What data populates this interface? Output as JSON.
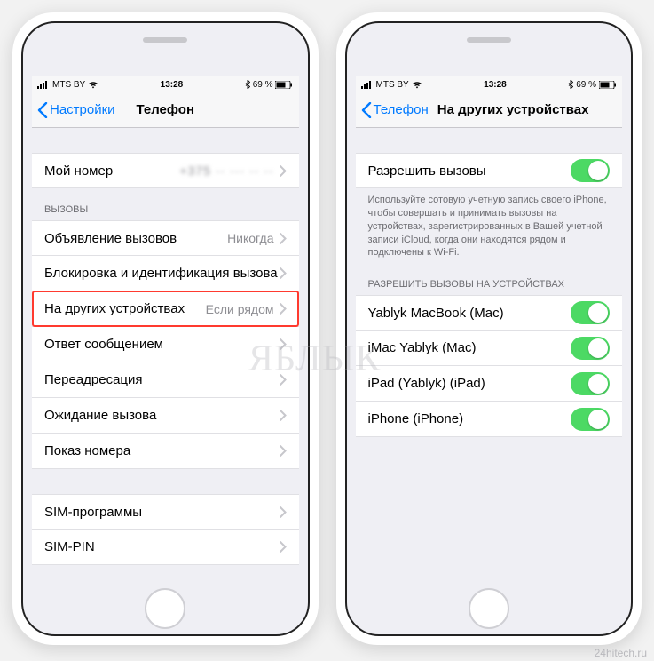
{
  "status": {
    "carrier": "MTS BY",
    "time": "13:28",
    "battery": "69 %"
  },
  "left": {
    "back": "Настройки",
    "title": "Телефон",
    "myNumberLabel": "Мой номер",
    "myNumberValue": "+375 ·· ··· ·· ··",
    "callsHeader": "ВЫЗОВЫ",
    "rows": {
      "announce": {
        "label": "Объявление вызовов",
        "detail": "Никогда"
      },
      "blocking": {
        "label": "Блокировка и идентификация вызова"
      },
      "otherDevices": {
        "label": "На других устройствах",
        "detail": "Если рядом"
      },
      "replyMsg": {
        "label": "Ответ сообщением"
      },
      "forwarding": {
        "label": "Переадресация"
      },
      "waiting": {
        "label": "Ожидание вызова"
      },
      "callerId": {
        "label": "Показ номера"
      },
      "simApps": {
        "label": "SIM-программы"
      },
      "simPin": {
        "label": "SIM-PIN"
      }
    }
  },
  "right": {
    "back": "Телефон",
    "title": "На других устройствах",
    "allowLabel": "Разрешить вызовы",
    "footer": "Используйте сотовую учетную запись своего iPhone, чтобы совершать и принимать вызовы на устройствах, зарегистрированных в Вашей учетной записи iCloud, когда они находятся рядом и подключены к Wi-Fi.",
    "devicesHeader": "РАЗРЕШИТЬ ВЫЗОВЫ НА УСТРОЙСТВАХ",
    "devices": [
      "Yablyk MacBook (Mac)",
      "iMac Yablyk (Mac)",
      "iPad (Yablyk) (iPad)",
      "iPhone (iPhone)"
    ]
  },
  "watermark": "ЯБЛЫК",
  "siteMark": "24hitech.ru"
}
